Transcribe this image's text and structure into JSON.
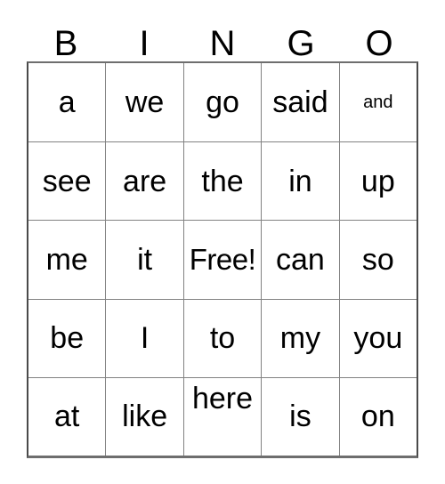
{
  "card": {
    "title": "BINGO",
    "headers": [
      "B",
      "I",
      "N",
      "G",
      "O"
    ],
    "rows": [
      [
        {
          "text": "a",
          "size": "normal",
          "align": "middle"
        },
        {
          "text": "we",
          "size": "normal",
          "align": "middle"
        },
        {
          "text": "go",
          "size": "normal",
          "align": "middle"
        },
        {
          "text": "said",
          "size": "normal",
          "align": "middle"
        },
        {
          "text": "and",
          "size": "small",
          "align": "middle"
        }
      ],
      [
        {
          "text": "see",
          "size": "normal",
          "align": "middle"
        },
        {
          "text": "are",
          "size": "normal",
          "align": "middle"
        },
        {
          "text": "the",
          "size": "normal",
          "align": "middle"
        },
        {
          "text": "in",
          "size": "normal",
          "align": "middle"
        },
        {
          "text": "up",
          "size": "normal",
          "align": "middle"
        }
      ],
      [
        {
          "text": "me",
          "size": "normal",
          "align": "middle"
        },
        {
          "text": "it",
          "size": "normal",
          "align": "middle"
        },
        {
          "text": "Free!",
          "size": "free",
          "align": "middle"
        },
        {
          "text": "can",
          "size": "normal",
          "align": "middle"
        },
        {
          "text": "so",
          "size": "normal",
          "align": "middle"
        }
      ],
      [
        {
          "text": "be",
          "size": "normal",
          "align": "middle"
        },
        {
          "text": "I",
          "size": "normal",
          "align": "middle"
        },
        {
          "text": "to",
          "size": "normal",
          "align": "middle"
        },
        {
          "text": "my",
          "size": "normal",
          "align": "middle"
        },
        {
          "text": "you",
          "size": "normal",
          "align": "middle"
        }
      ],
      [
        {
          "text": "at",
          "size": "normal",
          "align": "middle"
        },
        {
          "text": "like",
          "size": "normal",
          "align": "middle"
        },
        {
          "text": "here",
          "size": "normal",
          "align": "top"
        },
        {
          "text": "is",
          "size": "normal",
          "align": "middle"
        },
        {
          "text": "on",
          "size": "normal",
          "align": "middle"
        }
      ]
    ],
    "colors": {
      "background": "#ffffff",
      "text": "#000000",
      "inner_border": "#828282",
      "outer_border": "#4a4a4a"
    }
  }
}
